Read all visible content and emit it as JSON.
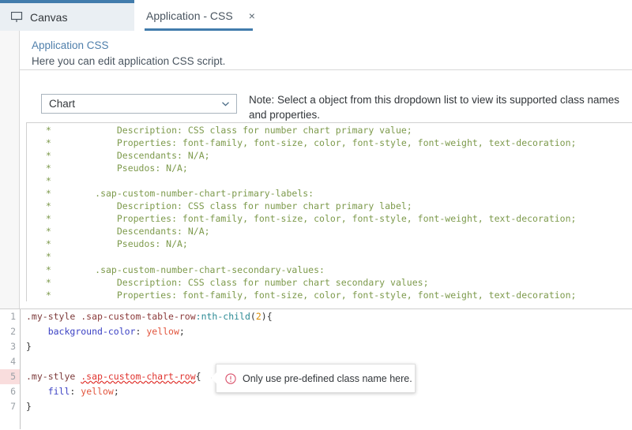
{
  "tabs": [
    {
      "label": "Canvas",
      "icon": "canvas-monitor-icon",
      "active": false
    },
    {
      "label": "Application - CSS",
      "icon": "",
      "active": true,
      "close": "×"
    }
  ],
  "panel": {
    "title": "Application CSS",
    "subtitle": "Here you can edit application CSS script."
  },
  "selector": {
    "value": "Chart",
    "caret": "chevron-down-icon",
    "options": [
      "Chart"
    ]
  },
  "note": {
    "text": "Note: Select a object from this dropdown list to view its supported class names and properties."
  },
  "doc": {
    "lines": [
      "  *            Description: CSS class for number chart primary value;",
      "  *            Properties: font-family, font-size, color, font-style, font-weight, text-decoration;",
      "  *            Descendants: N/A;",
      "  *            Pseudos: N/A;",
      "  *",
      "  *        .sap-custom-number-chart-primary-labels:",
      "  *            Description: CSS class for number chart primary label;",
      "  *            Properties: font-family, font-size, color, font-style, font-weight, text-decoration;",
      "  *            Descendants: N/A;",
      "  *            Pseudos: N/A;",
      "  *",
      "  *        .sap-custom-number-chart-secondary-values:",
      "  *            Description: CSS class for number chart secondary values;",
      "  *            Properties: font-family, font-size, color, font-style, font-weight, text-decoration;"
    ]
  },
  "editor": {
    "gutter": [
      "1",
      "2",
      "3",
      "4",
      "5",
      "6",
      "7"
    ],
    "error_line": 5,
    "lines": [
      {
        "n": "1",
        "tokens": [
          {
            "t": ".my-style",
            "c": "tok-sel"
          },
          {
            "t": " ",
            "c": "tok-punct"
          },
          {
            "t": ".sap-custom-table-row",
            "c": "tok-cls"
          },
          {
            "t": ":nth-child",
            "c": "tok-pseudo"
          },
          {
            "t": "(",
            "c": "tok-punct"
          },
          {
            "t": "2",
            "c": "tok-num"
          },
          {
            "t": ")",
            "c": "tok-punct"
          },
          {
            "t": "{",
            "c": "tok-brace"
          }
        ]
      },
      {
        "n": "2",
        "tokens": [
          {
            "t": "    ",
            "c": "tok-punct"
          },
          {
            "t": "background-color",
            "c": "tok-prop"
          },
          {
            "t": ": ",
            "c": "tok-punct"
          },
          {
            "t": "yellow",
            "c": "tok-val"
          },
          {
            "t": ";",
            "c": "tok-punct"
          }
        ]
      },
      {
        "n": "3",
        "tokens": [
          {
            "t": "}",
            "c": "tok-brace"
          }
        ]
      },
      {
        "n": "4",
        "tokens": [
          {
            "t": "",
            "c": "tok-punct"
          }
        ]
      },
      {
        "n": "5",
        "tokens": [
          {
            "t": ".my-stlye",
            "c": "tok-sel"
          },
          {
            "t": " ",
            "c": "tok-punct"
          },
          {
            "t": ".sap-custom-chart-row",
            "c": "tok-err"
          },
          {
            "t": "{",
            "c": "tok-brace"
          }
        ]
      },
      {
        "n": "6",
        "tokens": [
          {
            "t": "    ",
            "c": "tok-punct"
          },
          {
            "t": "fill",
            "c": "tok-prop"
          },
          {
            "t": ": ",
            "c": "tok-punct"
          },
          {
            "t": "yellow",
            "c": "tok-val"
          },
          {
            "t": ";",
            "c": "tok-punct"
          }
        ]
      },
      {
        "n": "7",
        "tokens": [
          {
            "t": "}",
            "c": "tok-brace"
          }
        ]
      }
    ]
  },
  "tooltip": {
    "icon": "error-circle-icon",
    "text": "Only use pre-defined class name here."
  },
  "colors": {
    "accent": "#427cac",
    "tab_inactive_bg": "#eaeff3",
    "doc_text": "#7d9a4c",
    "error": "#e0332e",
    "error_line_bg": "#f9dddd",
    "link": "#4f7fab"
  }
}
